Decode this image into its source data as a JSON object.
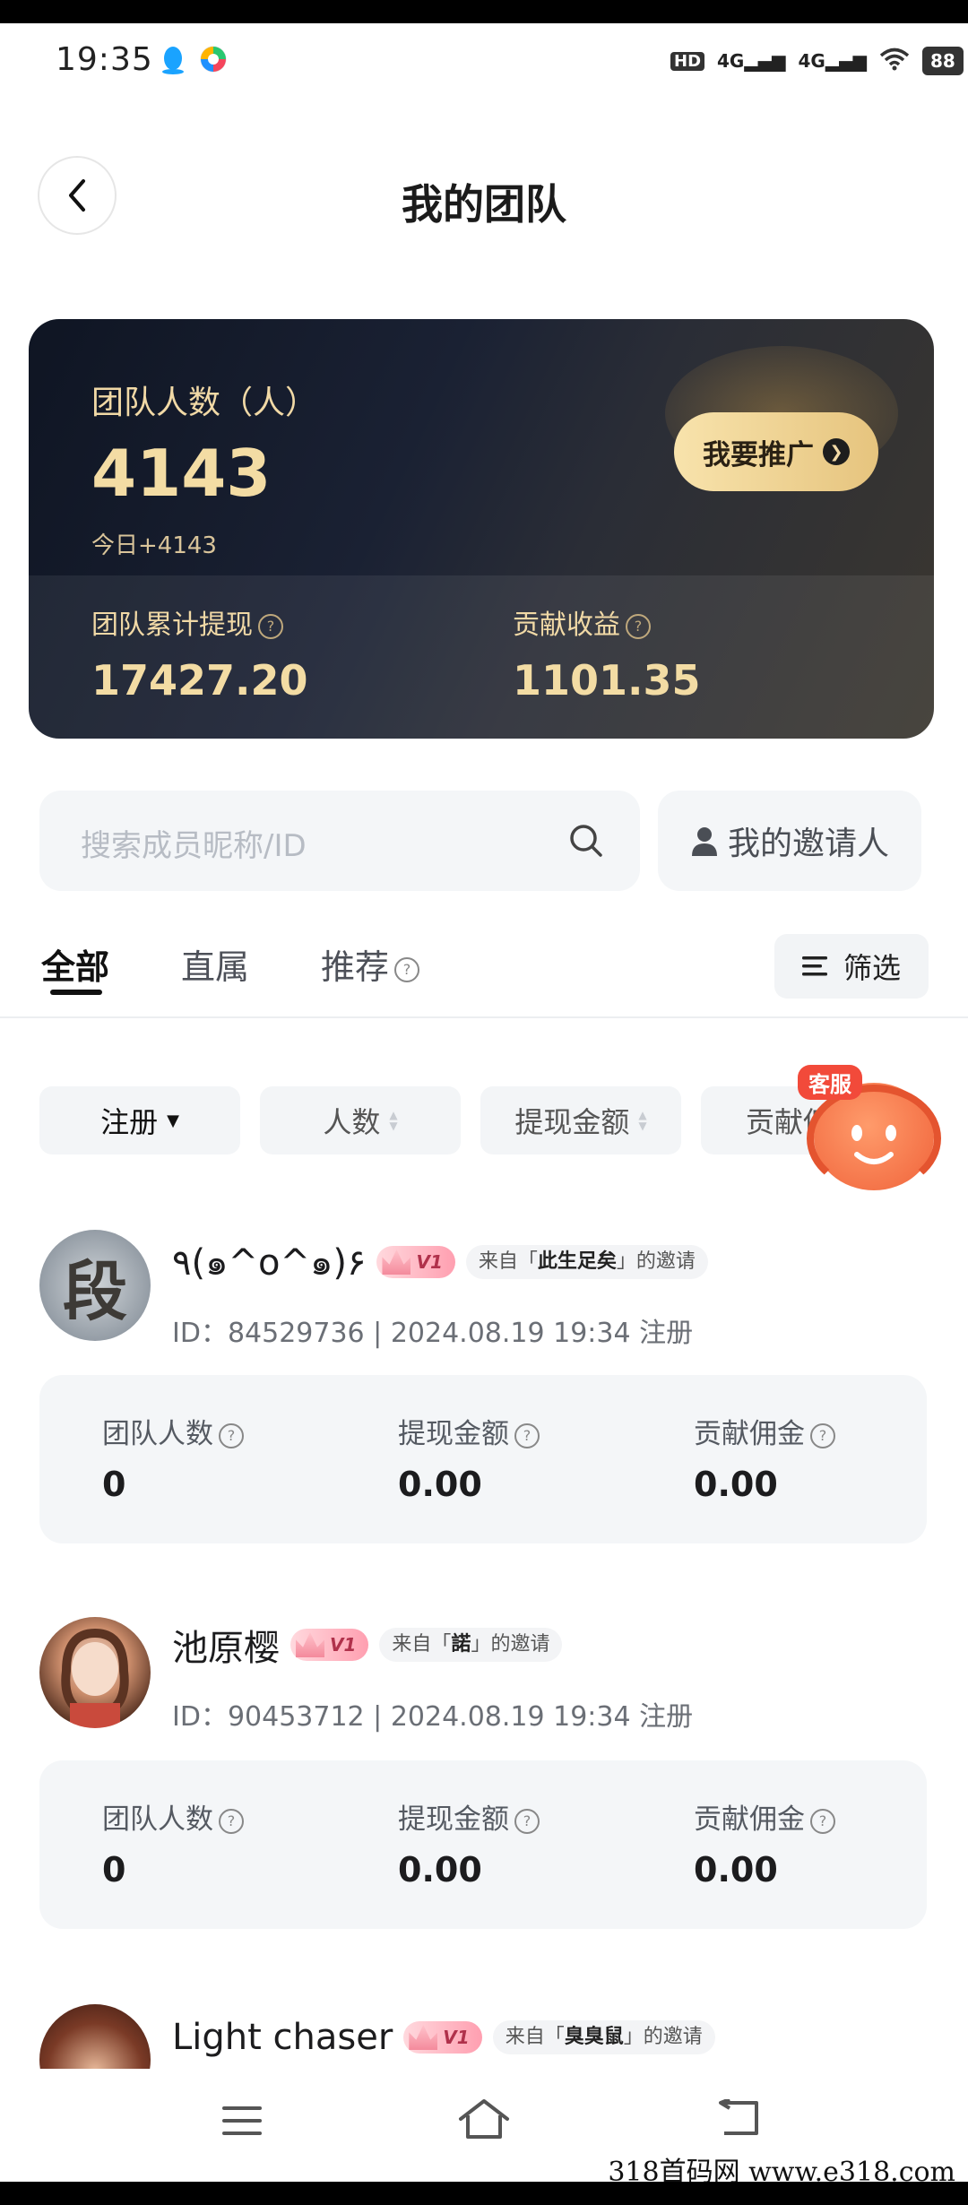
{
  "status_bar": {
    "time": "19:35",
    "network1": "4G",
    "network2": "4G",
    "battery": "88"
  },
  "header": {
    "title": "我的团队"
  },
  "summary": {
    "team_count_label": "团队人数（人）",
    "team_count": "4143",
    "today_label": "今日+4143",
    "promote_button": "我要推广",
    "withdraw_label": "团队累计提现",
    "withdraw_value": "17427.20",
    "contribution_label": "贡献收益",
    "contribution_value": "1101.35"
  },
  "search": {
    "placeholder": "搜索成员昵称/ID",
    "inviter_button": "我的邀请人"
  },
  "tabs": [
    {
      "label": "全部",
      "active": true
    },
    {
      "label": "直属",
      "active": false
    },
    {
      "label": "推荐",
      "active": false
    }
  ],
  "filter_button": "筛选",
  "sort_chips": [
    {
      "label": "注册",
      "active": true
    },
    {
      "label": "人数",
      "active": false
    },
    {
      "label": "提现金额",
      "active": false
    },
    {
      "label": "贡献佣",
      "active": false
    }
  ],
  "customer_service": {
    "label": "客服"
  },
  "members": [
    {
      "name": "٩(๑^o^๑)۶",
      "level": "V1",
      "from_prefix": "来自「",
      "from_name": "此生足矣",
      "from_suffix": "」的邀请",
      "meta": "ID：84529736 | 2024.08.19 19:34 注册",
      "avatar_char": "段",
      "stat_labels": [
        "团队人数",
        "提现金额",
        "贡献佣金"
      ],
      "stat_values": [
        "0",
        "0.00",
        "0.00"
      ]
    },
    {
      "name": "池原樱",
      "level": "V1",
      "from_prefix": "来自「",
      "from_name": "諾",
      "from_suffix": "」的邀请",
      "meta": "ID：90453712 | 2024.08.19 19:34 注册",
      "stat_labels": [
        "团队人数",
        "提现金额",
        "贡献佣金"
      ],
      "stat_values": [
        "0",
        "0.00",
        "0.00"
      ]
    },
    {
      "name": "Light chaser",
      "level": "V1",
      "from_prefix": "来自「",
      "from_name": "臭臭鼠",
      "from_suffix": "」的邀请"
    }
  ],
  "watermark": "318首码网 www.e318.com"
}
